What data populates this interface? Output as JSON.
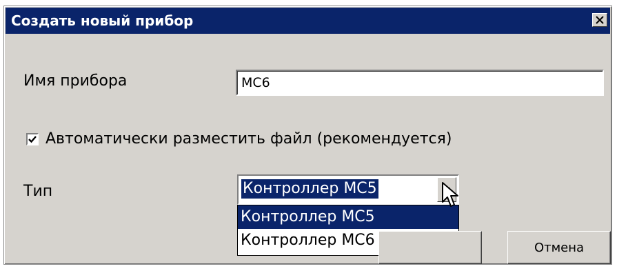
{
  "window": {
    "title": "Создать новый прибор",
    "close_symbol": "✕"
  },
  "form": {
    "name_label": "Имя прибора",
    "name_value": "MC6",
    "auto_place_label": "Автоматически разместить файл (рекомендуется)",
    "auto_place_checked": true,
    "type_label": "Тип",
    "type_selected": "Контроллер MC5",
    "type_options": [
      "Контроллер MC5",
      "Контроллер MC6"
    ]
  },
  "buttons": {
    "ok_label": "",
    "cancel_label": "Отмена"
  },
  "colors": {
    "titlebar": "#0a246a",
    "dialog_bg": "#d6d3ce",
    "selection": "#0a246a"
  }
}
